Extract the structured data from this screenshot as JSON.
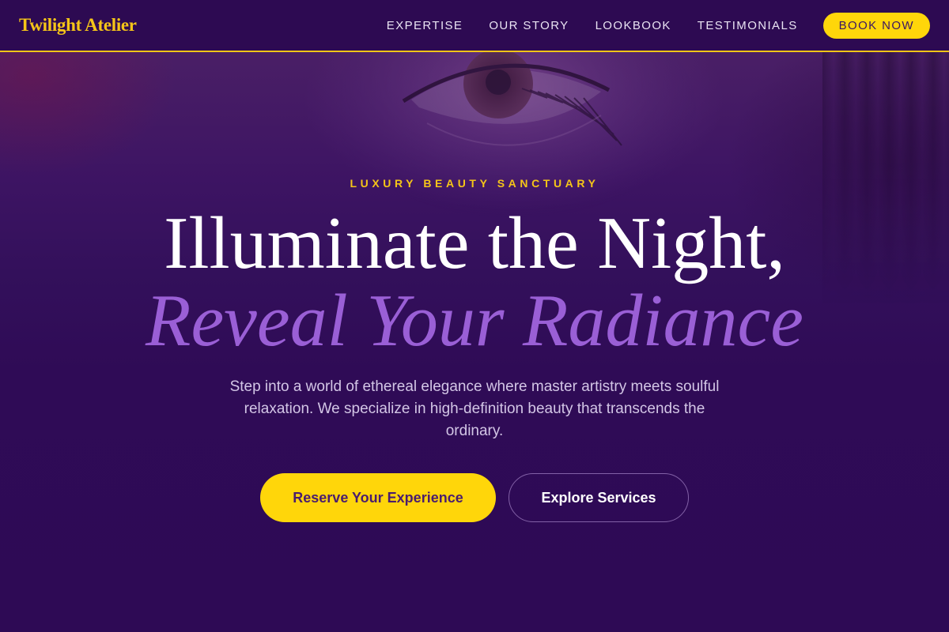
{
  "header": {
    "brand": "Twilight Atelier",
    "nav": [
      {
        "label": "EXPERTISE"
      },
      {
        "label": "OUR STORY"
      },
      {
        "label": "LOOKBOOK"
      },
      {
        "label": "TESTIMONIALS"
      }
    ],
    "book_label": "BOOK NOW"
  },
  "hero": {
    "eyebrow": "LUXURY BEAUTY SANCTUARY",
    "headline_line1": "Illuminate the Night,",
    "headline_line2": "Reveal Your Radiance",
    "lead": "Step into a world of ethereal elegance where master artistry meets soulful relaxation. We specialize in high-definition beauty that transcends the ordinary.",
    "primary_cta": "Reserve Your Experience",
    "secondary_cta": "Explore Services"
  },
  "colors": {
    "brand_gold": "#f5c518",
    "button_yellow": "#ffd60a",
    "background_purple": "#2e0a55",
    "accent_lavender": "#9a5fd6"
  },
  "icons": {
    "hero_background": "eye-with-lashes-photo"
  }
}
